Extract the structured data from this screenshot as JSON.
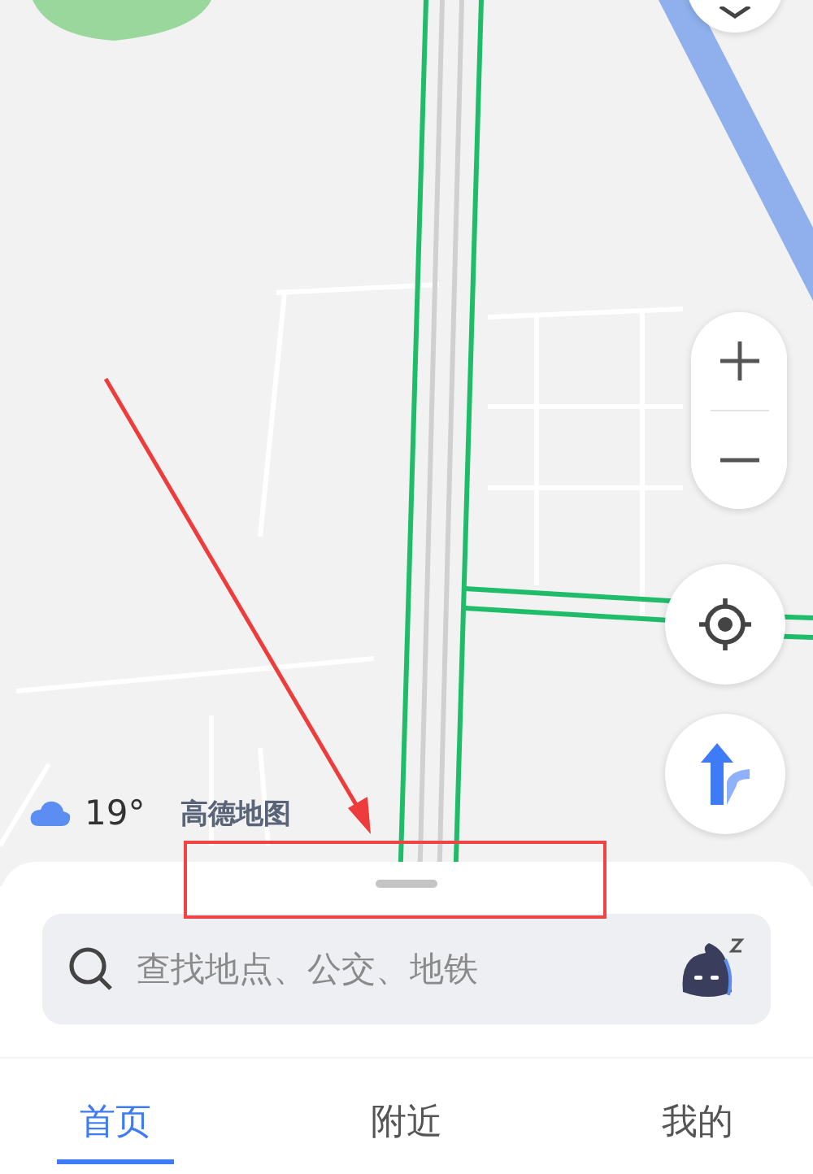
{
  "weather": {
    "temperature": "19°"
  },
  "map_logo": "高德地图",
  "search": {
    "placeholder": "查找地点、公交、地铁"
  },
  "tabs": [
    {
      "label": "首页",
      "selected": true
    },
    {
      "label": "附近",
      "selected": false
    },
    {
      "label": "我的",
      "selected": false
    }
  ]
}
